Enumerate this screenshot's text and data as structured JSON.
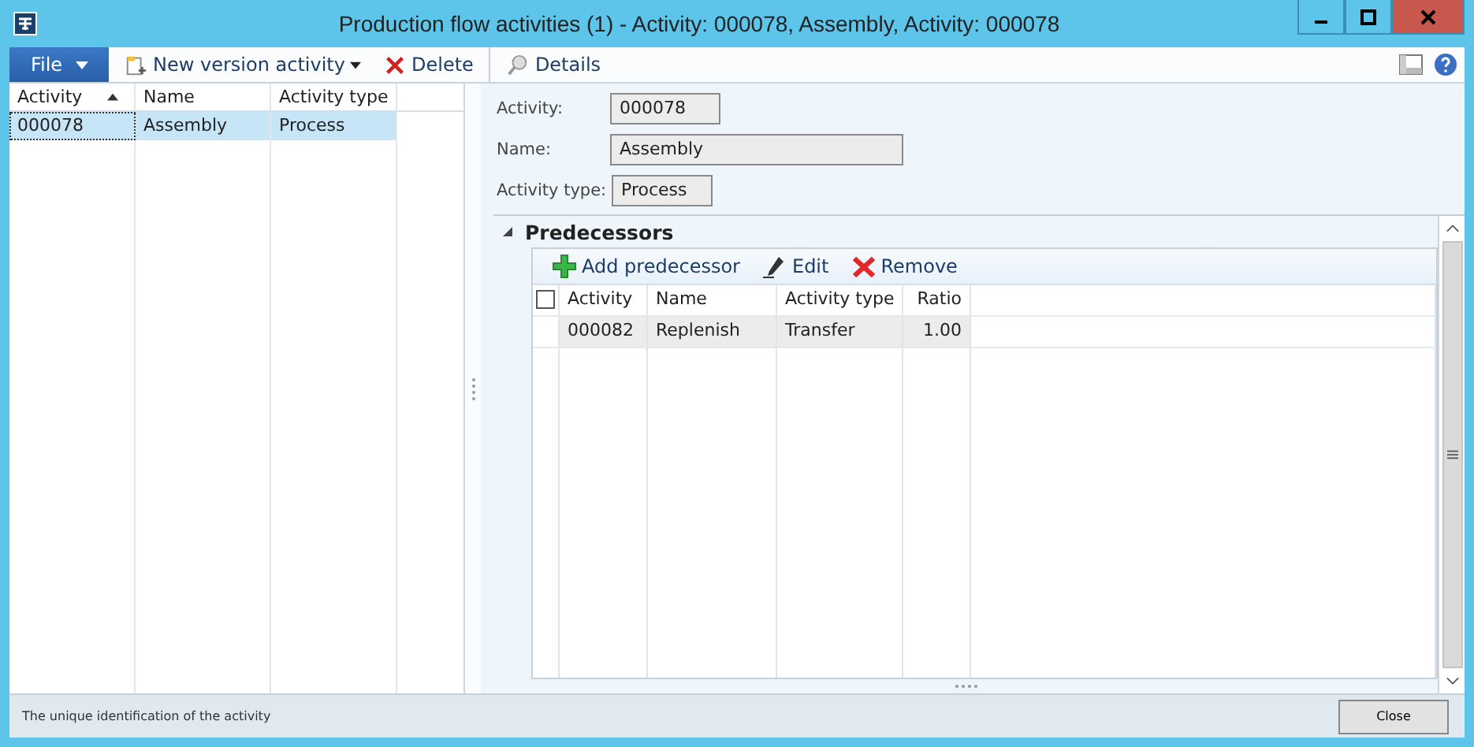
{
  "window": {
    "title": "Production flow activities (1) - Activity: 000078, Assembly, Activity: 000078"
  },
  "toolbar": {
    "file": "File",
    "items": [
      {
        "kind": "new",
        "label": "New version activity",
        "dropdown": true
      },
      {
        "kind": "delete",
        "label": "Delete",
        "dropdown": false
      },
      {
        "kind": "details",
        "label": "Details",
        "dropdown": false
      }
    ]
  },
  "list": {
    "columns": [
      {
        "label": "Activity",
        "sorted": true
      },
      {
        "label": "Name",
        "sorted": false
      },
      {
        "label": "Activity type",
        "sorted": false
      }
    ],
    "rows": [
      {
        "cells": [
          "000078",
          "Assembly",
          "Process"
        ],
        "selected": true
      }
    ]
  },
  "fields": [
    {
      "label": "Activity:",
      "value": "000078"
    },
    {
      "label": "Name:",
      "value": "Assembly"
    },
    {
      "label": "Activity type:",
      "value": "Process"
    }
  ],
  "predecessors": {
    "title": "Predecessors",
    "expanded": true,
    "select_all_checked": false,
    "actions": [
      {
        "kind": "add",
        "label": "Add predecessor"
      },
      {
        "kind": "edit",
        "label": "Edit"
      },
      {
        "kind": "remove",
        "label": "Remove"
      }
    ],
    "columns": [
      {
        "label": "Activity",
        "numeric": false
      },
      {
        "label": "Name",
        "numeric": false
      },
      {
        "label": "Activity type",
        "numeric": false
      },
      {
        "label": "Ratio",
        "numeric": true
      }
    ],
    "rows": [
      {
        "cells": [
          "000082",
          "Replenish",
          "Transfer",
          "1.00"
        ],
        "selected": true
      }
    ]
  },
  "status_bar": {
    "text": "The unique identification of the activity",
    "button": "Close"
  }
}
